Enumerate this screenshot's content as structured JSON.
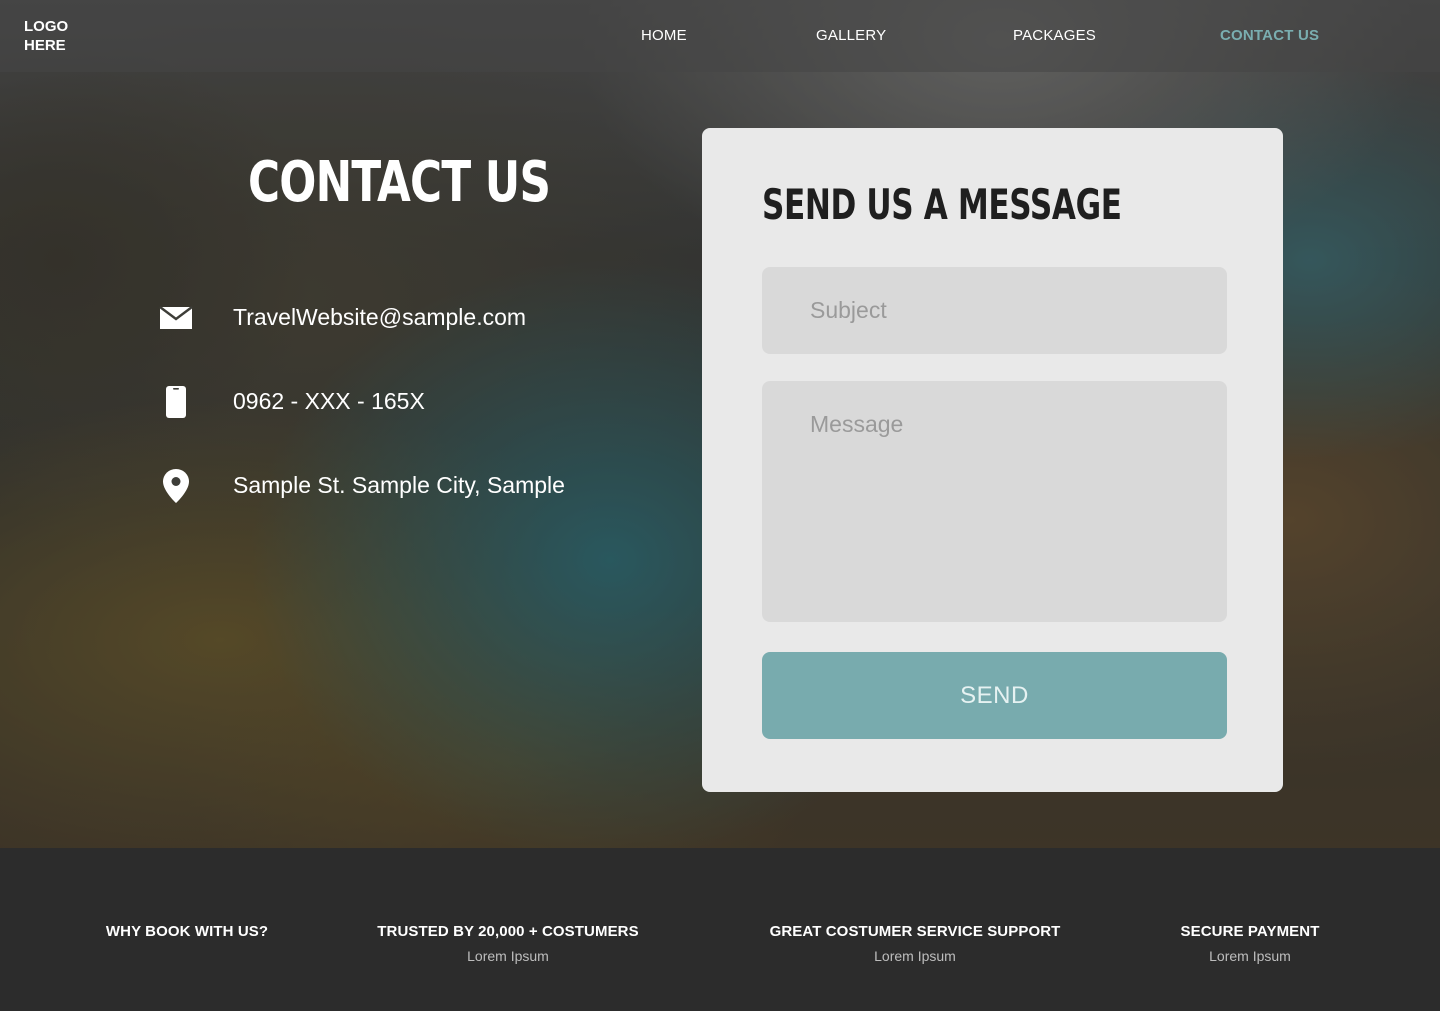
{
  "header": {
    "logo_text": "LOGO HERE",
    "nav": [
      {
        "label": "HOME"
      },
      {
        "label": "GALLERY"
      },
      {
        "label": "PACKAGES"
      },
      {
        "label": "CONTACT US",
        "active": true
      }
    ]
  },
  "contact": {
    "title": "CONTACT US",
    "email": "TravelWebsite@sample.com",
    "phone": "0962 - XXX - 165X",
    "address": "Sample St. Sample City, Sample",
    "icons": [
      "envelope-icon",
      "phone-icon",
      "location-pin-icon"
    ]
  },
  "form": {
    "title": "SEND US A MESSAGE",
    "subject_placeholder": "Subject",
    "message_placeholder": "Message",
    "send_label": "SEND"
  },
  "footer": {
    "features": [
      {
        "title": "WHY BOOK WITH US?",
        "subtitle": ""
      },
      {
        "title": "TRUSTED BY 20,000 + COSTUMERS",
        "subtitle": "Lorem Ipsum"
      },
      {
        "title": "GREAT COSTUMER SERVICE SUPPORT",
        "subtitle": "Lorem Ipsum"
      },
      {
        "title": "SECURE PAYMENT",
        "subtitle": "Lorem Ipsum"
      }
    ]
  },
  "colors": {
    "accent": "#78abae",
    "active_nav": "#7aaeb0",
    "card_bg": "#e9e9e9",
    "field_bg": "#d9d9d9",
    "footer_bg": "#2c2c2c"
  }
}
